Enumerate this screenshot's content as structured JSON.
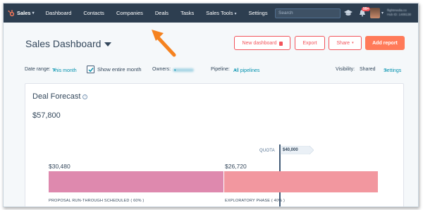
{
  "nav": {
    "brand": "Sales",
    "items": [
      {
        "label": "Dashboard",
        "has_dropdown": false
      },
      {
        "label": "Contacts",
        "has_dropdown": false
      },
      {
        "label": "Companies",
        "has_dropdown": false
      },
      {
        "label": "Deals",
        "has_dropdown": false
      },
      {
        "label": "Tasks",
        "has_dropdown": false
      },
      {
        "label": "Sales Tools",
        "has_dropdown": true
      },
      {
        "label": "Settings",
        "has_dropdown": false
      }
    ],
    "search_placeholder": "Search",
    "notification_count": "99+",
    "account_line_1": "flightmedia.co",
    "account_line_2": "Hub ID: 1408138"
  },
  "header": {
    "title": "Sales Dashboard",
    "buttons": {
      "new_dashboard": "New dashboard",
      "export": "Export",
      "share": "Share",
      "add_report": "Add report"
    }
  },
  "filters": {
    "date_range_label": "Date range:",
    "date_range_value": "This month",
    "show_entire_month_label": "Show entire month",
    "show_entire_month_checked": true,
    "owners_label": "Owners:",
    "pipeline_label": "Pipeline:",
    "pipeline_value": "All pipelines",
    "visibility_label": "Visibility:",
    "visibility_value": "Shared",
    "settings_label": "Settings"
  },
  "deal_forecast": {
    "title": "Deal Forecast",
    "total": "$57,800",
    "quota_label": "QUOTA",
    "quota_value": "$40,000",
    "segments": [
      {
        "value": "$30,480",
        "label": "PROPOSAL RUN-THROUGH SCHEDULED ( 60% )",
        "color": "#de89ae"
      },
      {
        "value": "$26,720",
        "label": "EXPLORATORY PHASE ( 40% )",
        "color": "#f2979f"
      }
    ]
  },
  "colors": {
    "nav_bg": "#2d3e50",
    "accent": "#ff7a59",
    "link": "#0091ae",
    "annotation_arrow": "#f5821f"
  },
  "icons": {
    "brand": "hubspot-sprocket-icon",
    "academy": "graduation-cap-icon",
    "notifications": "bell-icon",
    "info": "info-icon",
    "lock": "lock-icon"
  }
}
